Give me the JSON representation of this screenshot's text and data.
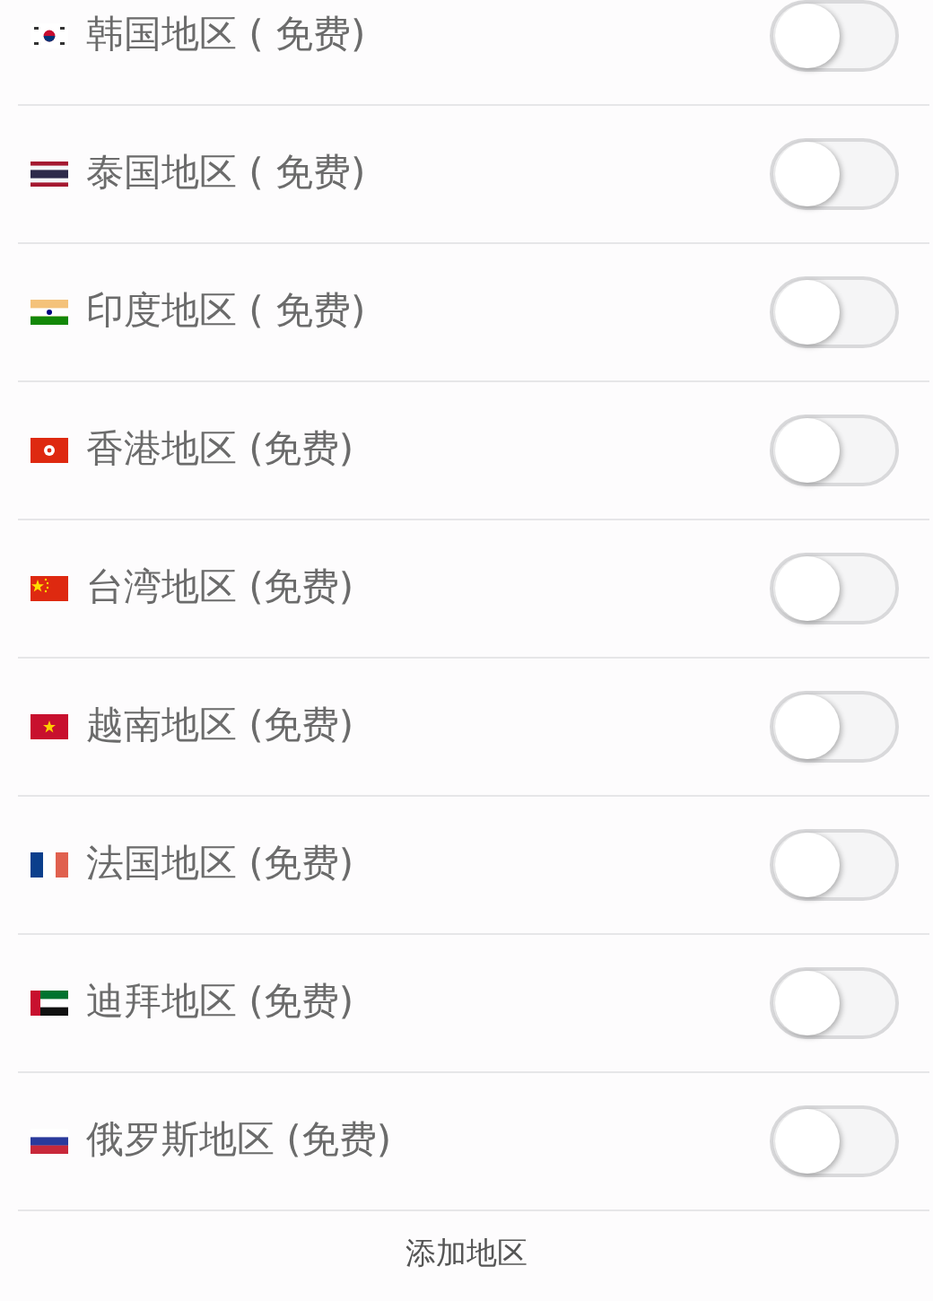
{
  "regions": [
    {
      "kind": "kr",
      "label": "韩国地区 ( 免费)",
      "on": false
    },
    {
      "kind": "th",
      "label": "泰国地区 ( 免费)",
      "on": false
    },
    {
      "kind": "in",
      "label": "印度地区 ( 免费)",
      "on": false
    },
    {
      "kind": "hk",
      "label": "香港地区 (免费)",
      "on": false
    },
    {
      "kind": "cn",
      "label": "台湾地区 (免费)",
      "on": false
    },
    {
      "kind": "vn",
      "label": "越南地区 (免费)",
      "on": false
    },
    {
      "kind": "fr",
      "label": "法国地区 (免费)",
      "on": false
    },
    {
      "kind": "ae",
      "label": "迪拜地区 (免费)",
      "on": false
    },
    {
      "kind": "ru",
      "label": "俄罗斯地区 (免费)",
      "on": false
    }
  ],
  "add_button": "添加地区"
}
